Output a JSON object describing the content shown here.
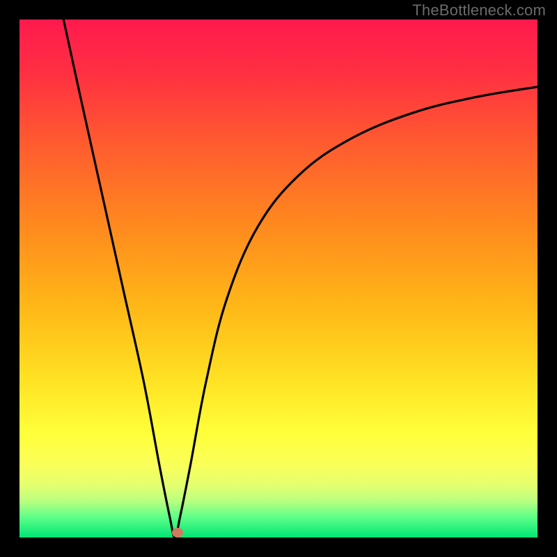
{
  "watermark": "TheBottleneck.com",
  "gradient_stops": [
    {
      "pct": 0,
      "color": "#ff1a4e"
    },
    {
      "pct": 10,
      "color": "#ff2f42"
    },
    {
      "pct": 25,
      "color": "#ff5e2e"
    },
    {
      "pct": 40,
      "color": "#ff8a1e"
    },
    {
      "pct": 55,
      "color": "#ffb617"
    },
    {
      "pct": 70,
      "color": "#ffe324"
    },
    {
      "pct": 80,
      "color": "#ffff3a"
    },
    {
      "pct": 86,
      "color": "#faff5a"
    },
    {
      "pct": 90,
      "color": "#e3ff70"
    },
    {
      "pct": 93,
      "color": "#b9ff80"
    },
    {
      "pct": 96,
      "color": "#5fff88"
    },
    {
      "pct": 100,
      "color": "#00e676"
    }
  ],
  "marker": {
    "x_pct": 30.5,
    "y_pct": 99.0,
    "color": "#cf7a60"
  },
  "chart_data": {
    "type": "line",
    "title": "",
    "xlabel": "",
    "ylabel": "",
    "xlim": [
      0,
      100
    ],
    "ylim": [
      0,
      100
    ],
    "grid": false,
    "legend": false,
    "note": "V-shaped bottleneck curve. Minimum (optimal balance) at x≈30, y≈0. Values read off pixel geometry; no numeric axis labels are present in the image.",
    "series": [
      {
        "name": "left-branch",
        "x": [
          8.5,
          12,
          16,
          20,
          24,
          27,
          29,
          30
        ],
        "y": [
          100,
          84,
          66,
          48,
          30,
          14,
          4,
          0
        ]
      },
      {
        "name": "right-branch",
        "x": [
          30,
          31,
          33,
          36,
          40,
          46,
          54,
          64,
          76,
          88,
          100
        ],
        "y": [
          0,
          4,
          14,
          30,
          46,
          60,
          70,
          77,
          82,
          85,
          87
        ]
      }
    ],
    "marker_point": {
      "x": 30.5,
      "y": 1
    }
  }
}
